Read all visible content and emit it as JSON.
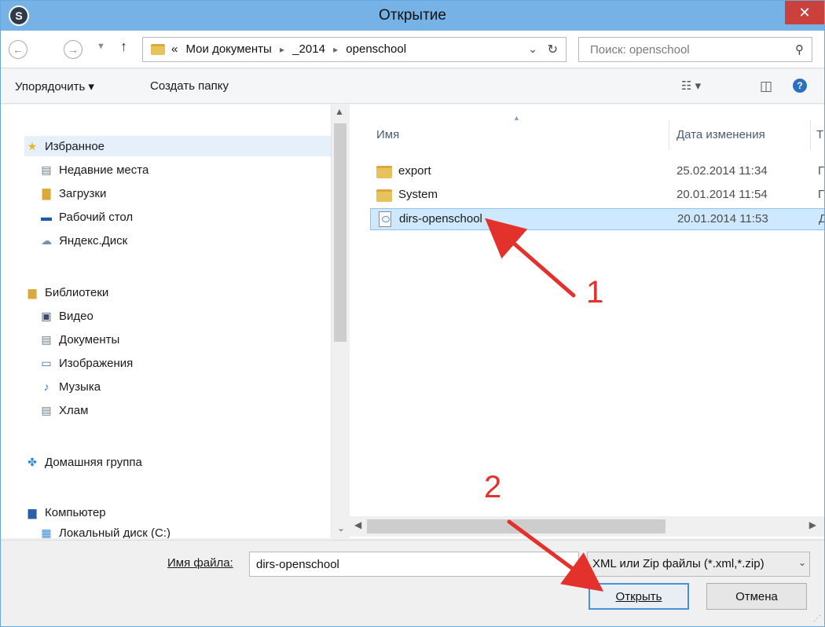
{
  "window": {
    "title": "Открытие",
    "app_icon": "s-logo-icon",
    "close_label": "✕"
  },
  "nav": {
    "back_icon": "back-arrow-icon",
    "forward_icon": "forward-arrow-icon",
    "up_icon": "up-arrow-icon",
    "breadcrumb": [
      "«",
      "Мои документы",
      "_2014",
      "openschool"
    ],
    "search_placeholder": "Поиск: openschool"
  },
  "toolbar": {
    "organize_label": "Упорядочить ▾",
    "new_folder_label": "Создать папку"
  },
  "sidebar": {
    "favorites_head": "Избранное",
    "favorites": [
      "Недавние места",
      "Загрузки",
      "Рабочий стол",
      "Яндекс.Диск"
    ],
    "libraries_head": "Библиотеки",
    "libraries": [
      "Видео",
      "Документы",
      "Изображения",
      "Музыка",
      "Хлам"
    ],
    "homegroup": "Домашняя группа",
    "computer_head": "Компьютер",
    "computer_items": [
      "Локальный диск (C:)"
    ]
  },
  "columns": {
    "name": "Имя",
    "date": "Дата изменения",
    "type": "Т"
  },
  "files": [
    {
      "name": "export",
      "date": "25.02.2014 11:34",
      "type": "Г",
      "kind": "folder"
    },
    {
      "name": "System",
      "date": "20.01.2014 11:54",
      "type": "Г",
      "kind": "folder"
    },
    {
      "name": "dirs-openschool",
      "date": "20.01.2014 11:53",
      "type": "Д",
      "kind": "file"
    }
  ],
  "bottom": {
    "filename_label": "Имя файла:",
    "filename_value": "dirs-openschool",
    "filetype": "XML или Zip файлы (*.xml,*.zip)",
    "open_label": "Открыть",
    "cancel_label": "Отмена"
  },
  "annotations": {
    "step1": "1",
    "step2": "2",
    "color": "#e3312c"
  },
  "colors": {
    "titlebar": "#76b2e6",
    "close": "#c9413a",
    "selection": "#cde8ff"
  }
}
